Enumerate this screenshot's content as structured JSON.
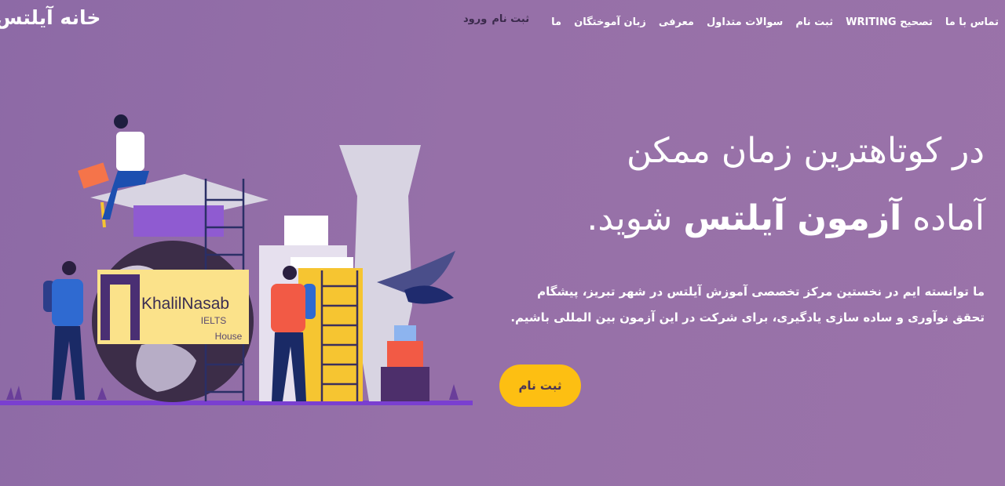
{
  "header": {
    "logo_text": "خانه آیلتس",
    "nav": [
      {
        "label": "ما"
      },
      {
        "label": "زبان آموختگان"
      },
      {
        "label": "معرفی"
      },
      {
        "label": "سوالات متداول"
      },
      {
        "label": "ثبت نام"
      },
      {
        "label": "تصحیح WRITING"
      },
      {
        "label": "تماس با ما"
      }
    ],
    "register_link": "ثبت نام",
    "login_link": "ورود"
  },
  "hero": {
    "title_line1": "در کوتاهترین زمان ممکن",
    "title_line2_pre": "آماده ",
    "title_line2_bold": "آزمون آیلتس",
    "title_line2_post": " شوید.",
    "description_line1": "ما توانسته ایم در نخستین مرکز تخصصی آموزش آیلتس در شهر تبریز، پیشگام",
    "description_line2": "تحقق نوآوری و ساده سازی یادگیری، برای شرکت در این آزمون بین المللی باشیم.",
    "cta_label": "ثبت نام"
  },
  "illustration": {
    "sign_brand": "KhalilNasab",
    "sign_line2": "IELTS",
    "sign_line3": "House"
  },
  "colors": {
    "accent": "#fdbf12",
    "background": "#9670a8",
    "ground": "#7a3fd0"
  }
}
